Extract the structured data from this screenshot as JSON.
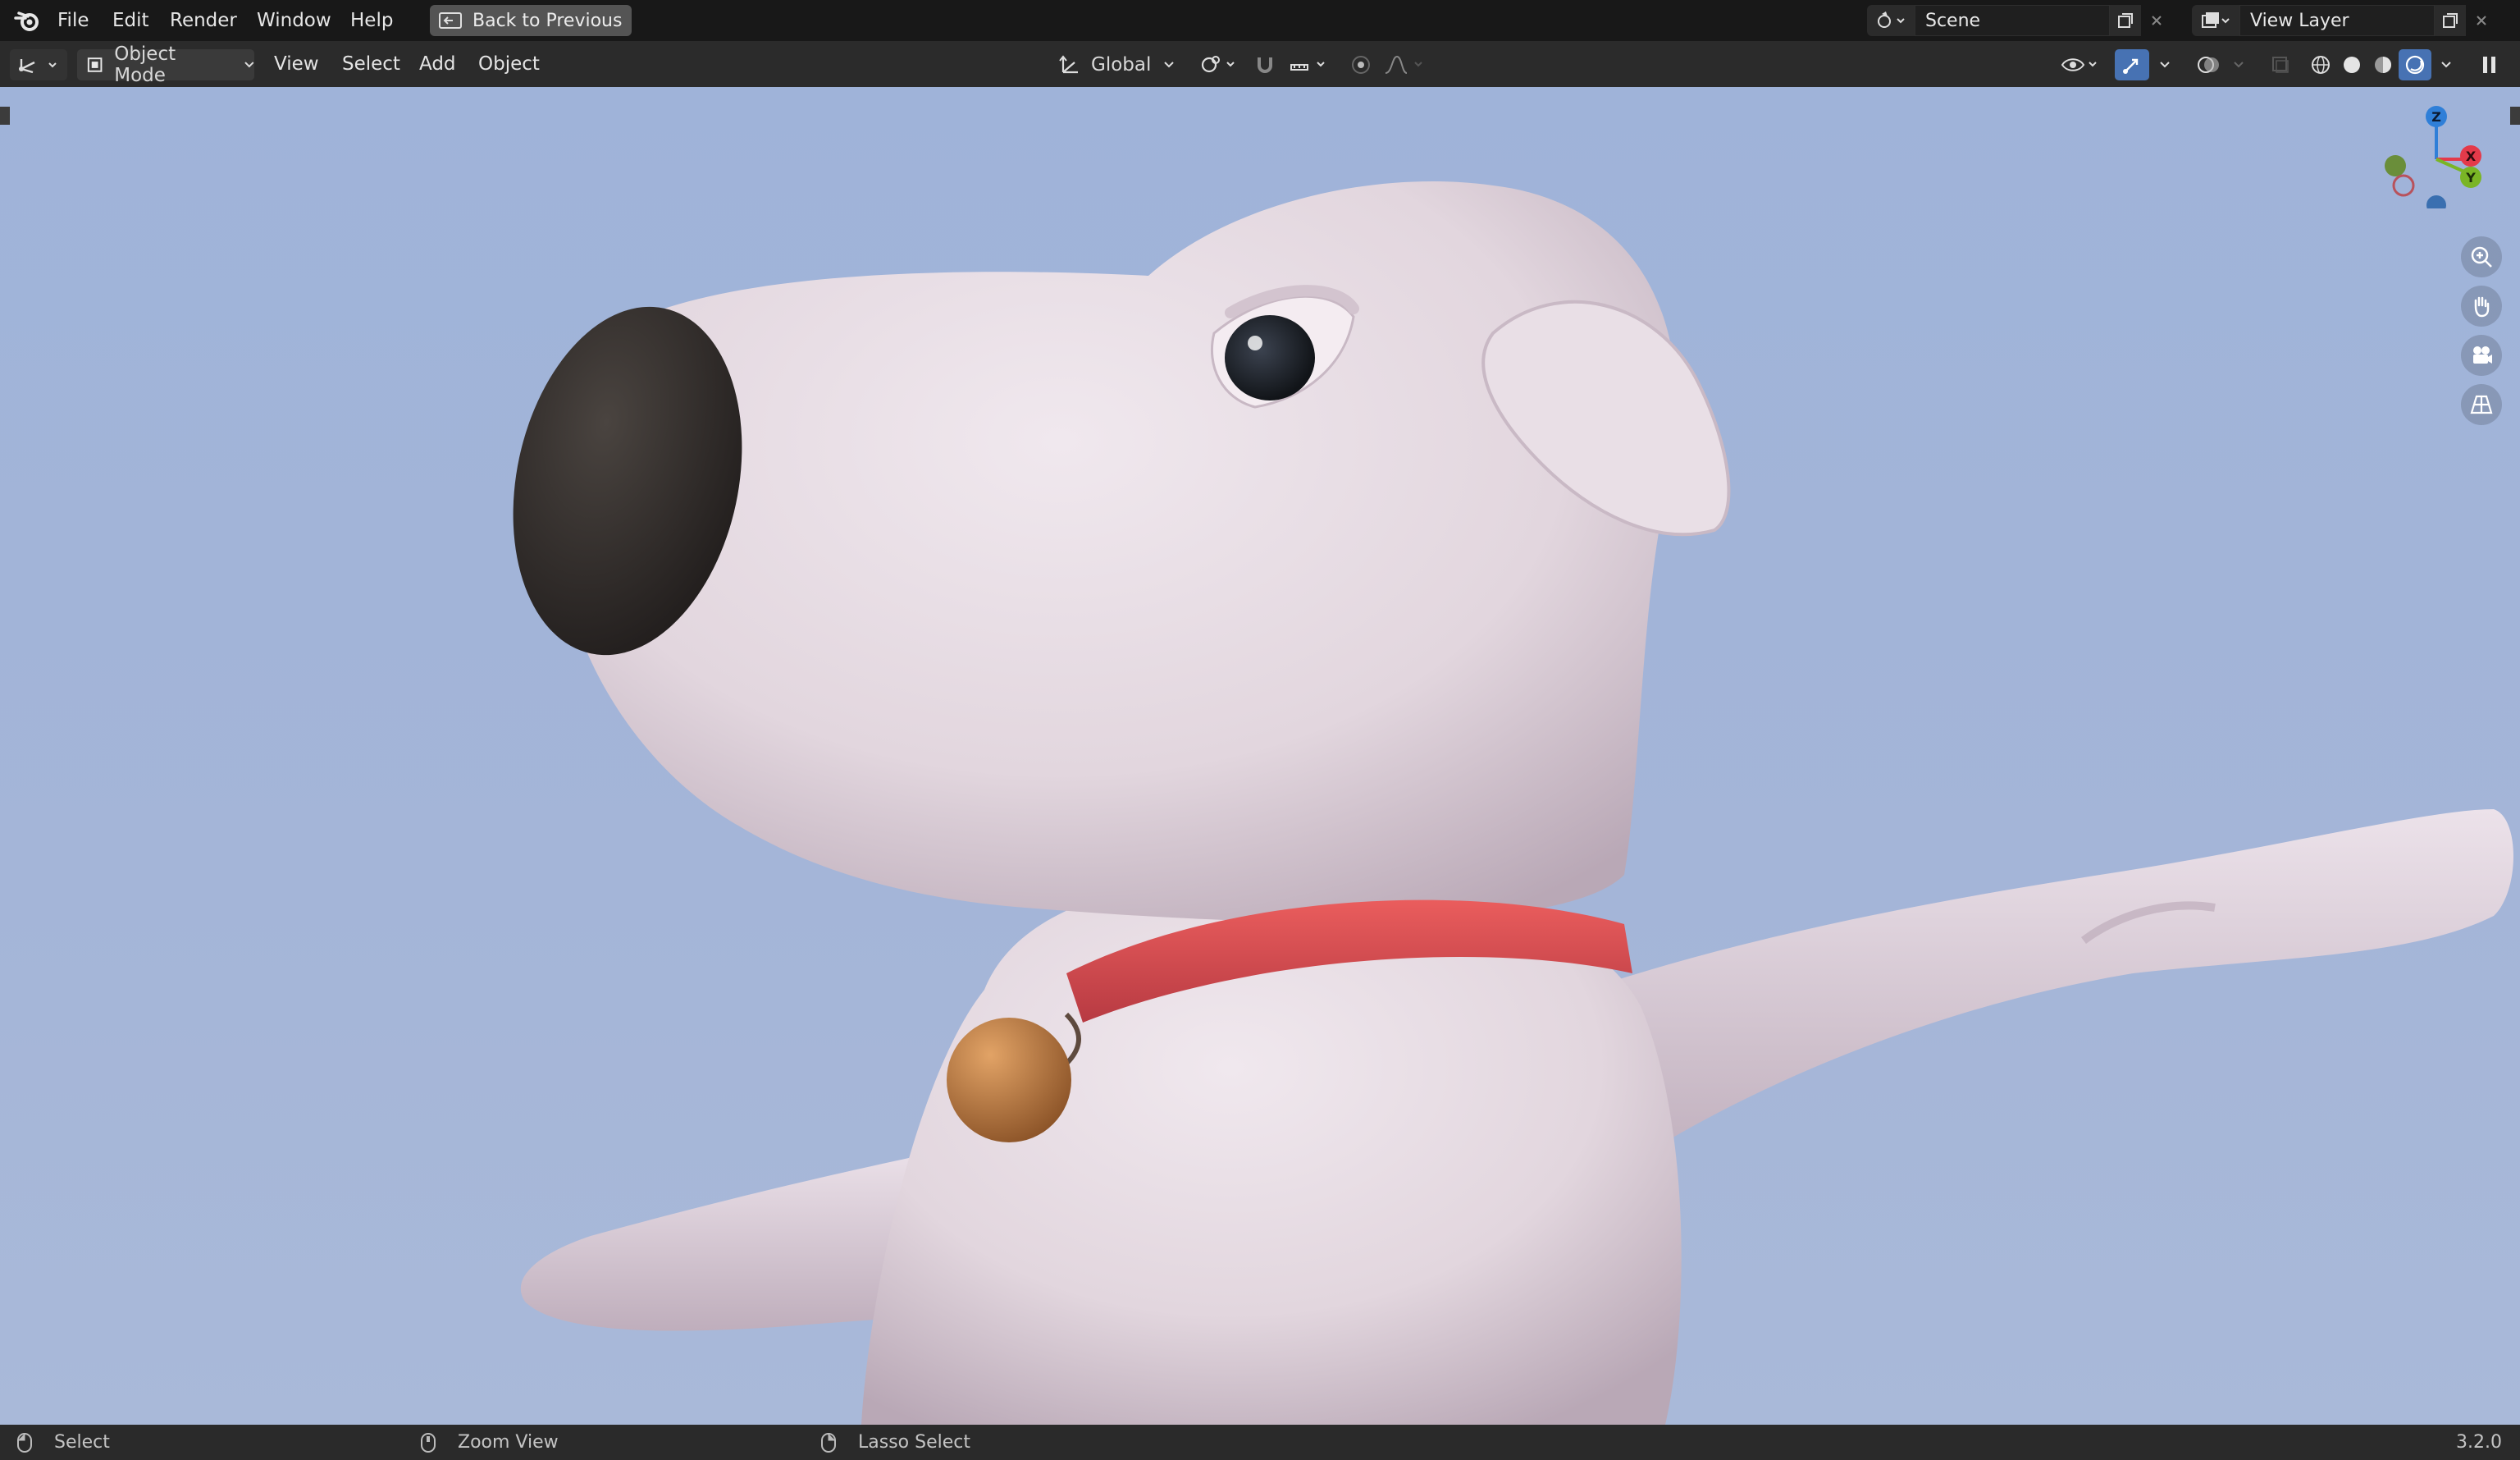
{
  "topbar": {
    "menus": [
      "File",
      "Edit",
      "Render",
      "Window",
      "Help"
    ],
    "back_button": "Back to Previous",
    "scene": {
      "value": "Scene"
    },
    "view_layer": {
      "value": "View Layer"
    }
  },
  "header": {
    "mode": "Object Mode",
    "menus": [
      "View",
      "Select",
      "Add",
      "Object"
    ],
    "transform_orientation": "Global",
    "shading_mode": "rendered"
  },
  "viewport": {
    "gizmo_axes": [
      "Z",
      "X",
      "Y"
    ],
    "icons": [
      "zoom-icon",
      "hand-pan-icon",
      "camera-icon",
      "grid-icon"
    ],
    "colors": {
      "background": "#a4b5d8",
      "fur": "#e7dde4",
      "nose": "#2f2a28",
      "collar": "#e05355",
      "bell": "#c08044",
      "axis_x": "#e43a4a",
      "axis_y": "#7ab525",
      "axis_z": "#2f7fd8"
    }
  },
  "statusbar": {
    "left": "Select",
    "middle": "Zoom View",
    "right": "Lasso Select",
    "version": "3.2.0"
  }
}
